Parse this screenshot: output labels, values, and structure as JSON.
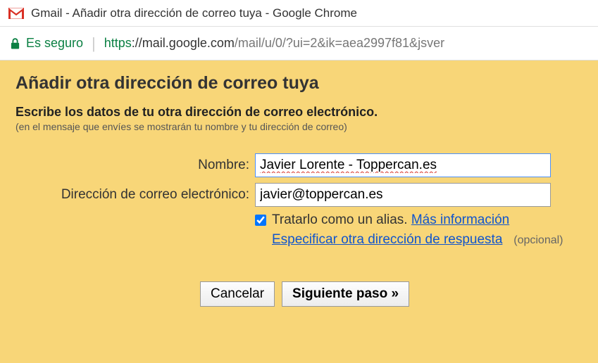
{
  "window": {
    "title": "Gmail - Añadir otra dirección de correo tuya - Google Chrome"
  },
  "addressbar": {
    "secure_label": "Es seguro",
    "url_scheme": "https",
    "url_host": "://mail.google.com",
    "url_path": "/mail/u/0/?ui=2&ik=aea2997f81&jsver"
  },
  "page": {
    "title": "Añadir otra dirección de correo tuya",
    "subtitle": "Escribe los datos de tu otra dirección de correo electrónico.",
    "note": "(en el mensaje que envíes se mostrarán tu nombre y tu dirección de correo)"
  },
  "form": {
    "name_label": "Nombre:",
    "name_value": "Javier Lorente - Toppercan.es",
    "email_label": "Dirección de correo electrónico:",
    "email_value": "javier@toppercan.es",
    "alias_label": "Tratarlo como un alias.",
    "alias_checked": true,
    "more_info": "Más información",
    "reply_to_link": "Especificar otra dirección de respuesta",
    "optional": "(opcional)"
  },
  "buttons": {
    "cancel": "Cancelar",
    "next": "Siguiente paso »"
  }
}
